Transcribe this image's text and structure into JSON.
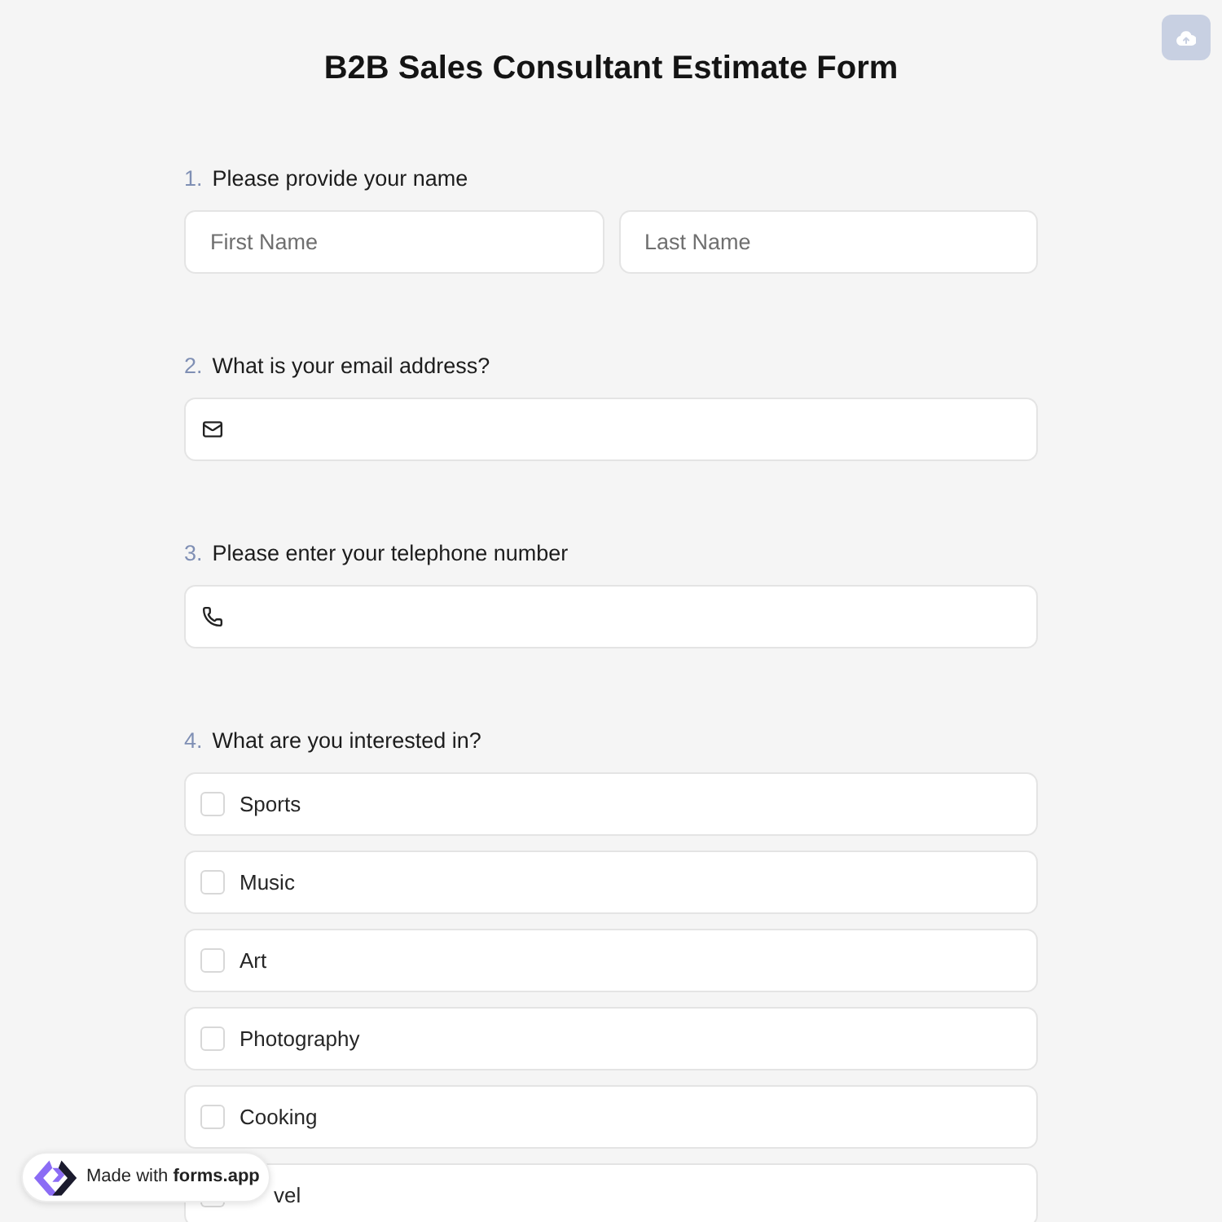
{
  "title": "B2B Sales Consultant Estimate Form",
  "questions": [
    {
      "number": "1.",
      "label": "Please provide your name",
      "kind": "name",
      "fields": [
        {
          "placeholder": "First Name"
        },
        {
          "placeholder": "Last Name"
        }
      ]
    },
    {
      "number": "2.",
      "label": "What is your email address?",
      "kind": "email"
    },
    {
      "number": "3.",
      "label": "Please enter your telephone number",
      "kind": "phone"
    },
    {
      "number": "4.",
      "label": "What are you interested in?",
      "kind": "checkboxes",
      "options": [
        {
          "label": "Sports",
          "checked": false
        },
        {
          "label": "Music",
          "checked": false
        },
        {
          "label": "Art",
          "checked": false
        },
        {
          "label": "Photography",
          "checked": false
        },
        {
          "label": "Cooking",
          "checked": false
        },
        {
          "label": "vel",
          "checked": false,
          "partly_hidden": true
        }
      ]
    }
  ],
  "badge": {
    "text": "Made with **forms.app**"
  }
}
